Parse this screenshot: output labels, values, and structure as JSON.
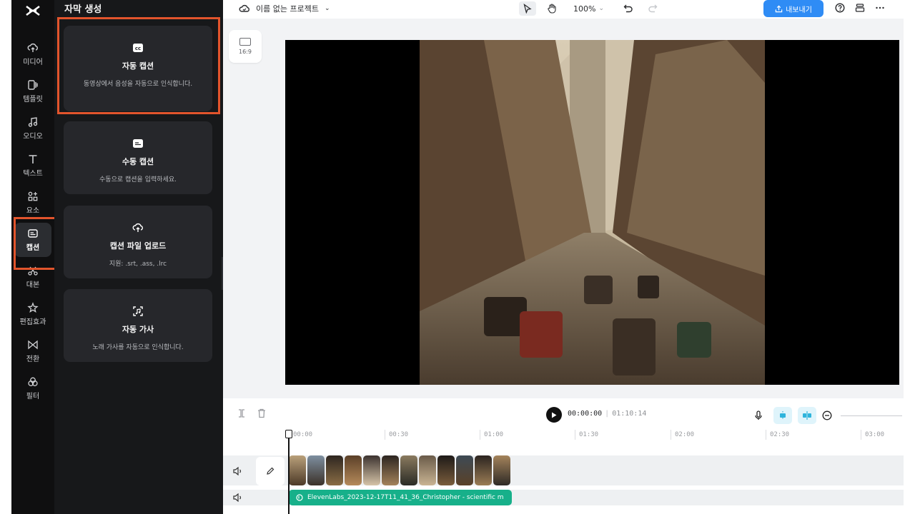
{
  "rail": {
    "items": [
      {
        "label": "미디어",
        "icon": "cloud-upload-icon"
      },
      {
        "label": "템플릿",
        "icon": "template-icon"
      },
      {
        "label": "오디오",
        "icon": "music-note-icon"
      },
      {
        "label": "텍스트",
        "icon": "text-icon"
      },
      {
        "label": "요소",
        "icon": "elements-icon"
      },
      {
        "label": "캡션",
        "icon": "caption-icon",
        "active": true
      },
      {
        "label": "대본",
        "icon": "script-icon"
      },
      {
        "label": "편집효과",
        "icon": "effects-icon"
      },
      {
        "label": "전환",
        "icon": "transition-icon"
      },
      {
        "label": "필터",
        "icon": "filter-icon"
      }
    ]
  },
  "panel": {
    "title": "자막 생성",
    "cards": [
      {
        "title": "자동 캡션",
        "desc": "동영상에서 음성을 자동으로 인식합니다.",
        "icon": "cc-icon"
      },
      {
        "title": "수동 캡션",
        "desc": "수동으로 캡션을 입력하세요.",
        "icon": "subtitle-icon"
      },
      {
        "title": "캡션 파일 업로드",
        "desc": "지원: .srt, .ass, .lrc",
        "icon": "cloud-upload-icon"
      },
      {
        "title": "자동 가사",
        "desc": "노래 가사를 자동으로 인식합니다.",
        "icon": "lyrics-scan-icon"
      }
    ]
  },
  "topbar": {
    "project_name": "이름 없는 프로젝트",
    "zoom": "100%",
    "export_label": "내보내기"
  },
  "canvas": {
    "ratio_label": "16:9"
  },
  "player": {
    "current_time": "00:00:00",
    "separator": "|",
    "duration": "01:10:14"
  },
  "timeline": {
    "ticks": [
      "00:00",
      "00:30",
      "01:00",
      "01:30",
      "02:00",
      "02:30",
      "03:00"
    ],
    "audio_clip_name": "ElevenLabs_2023-12-17T11_41_36_Christopher - scientific m"
  },
  "colors": {
    "accent": "#2f8cf5",
    "highlight": "#e2542c",
    "audio_clip": "#17b08a"
  }
}
